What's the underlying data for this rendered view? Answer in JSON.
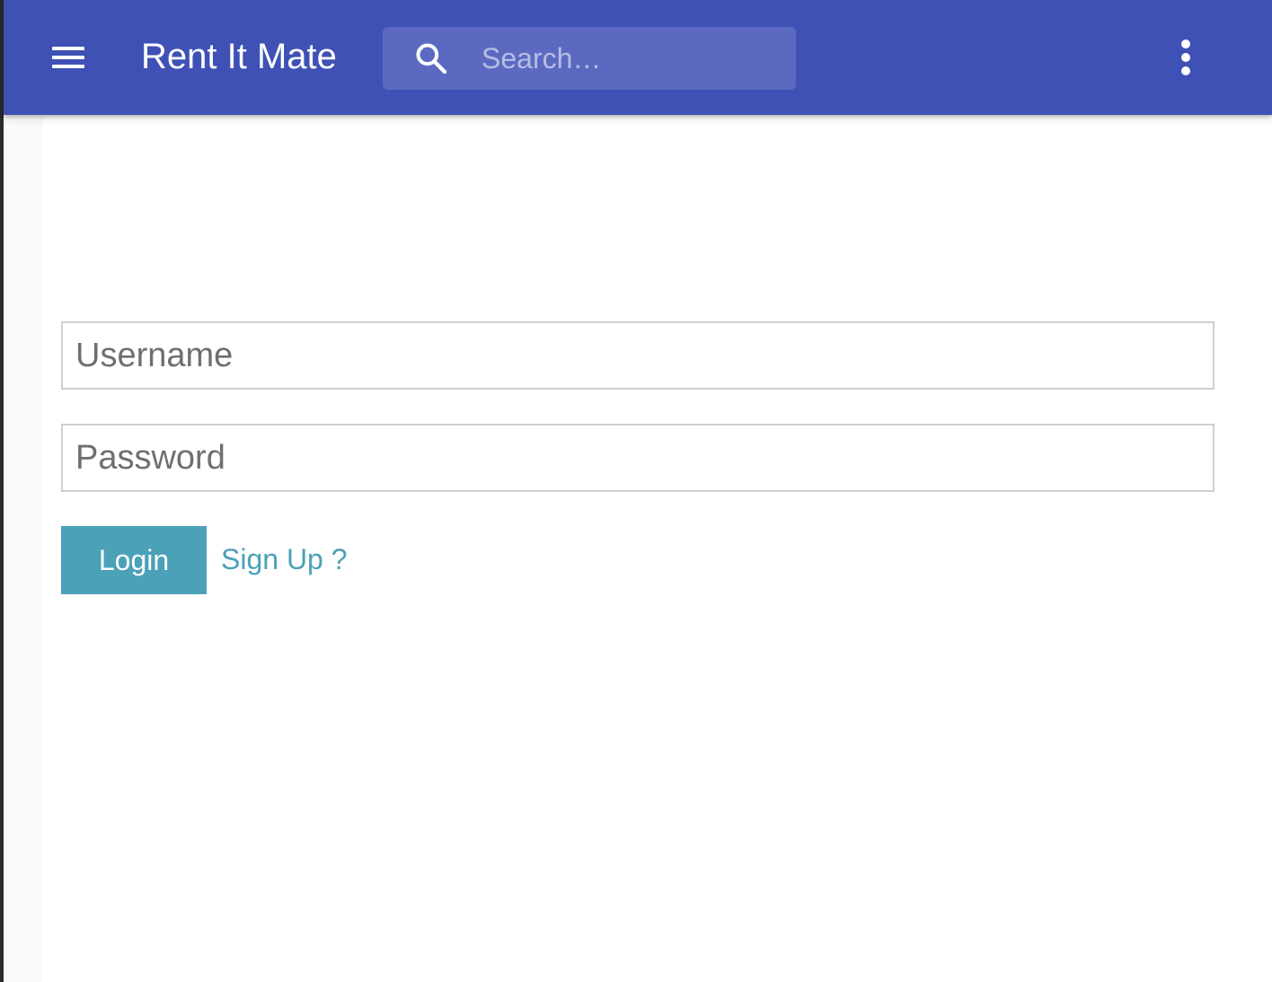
{
  "app": {
    "title": "Rent It Mate"
  },
  "appbar": {
    "color": "#3f51b5",
    "menu_icon": "hamburger-menu-icon",
    "more_icon": "more-vertical-icon"
  },
  "search": {
    "icon": "search-icon",
    "placeholder": "Search…",
    "value": ""
  },
  "login_form": {
    "username_placeholder": "Username",
    "username_value": "",
    "password_placeholder": "Password",
    "password_value": "",
    "login_label": "Login",
    "signup_label": "Sign Up ?",
    "accent_color": "#4aa1b8"
  }
}
